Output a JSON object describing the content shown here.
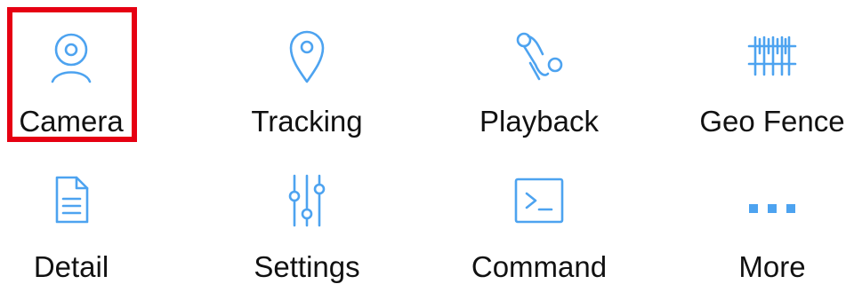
{
  "menu": {
    "items": [
      {
        "label": "Camera",
        "icon": "camera-icon"
      },
      {
        "label": "Tracking",
        "icon": "location-pin-icon"
      },
      {
        "label": "Playback",
        "icon": "route-icon"
      },
      {
        "label": "Geo Fence",
        "icon": "fence-icon"
      },
      {
        "label": "Detail",
        "icon": "document-icon"
      },
      {
        "label": "Settings",
        "icon": "sliders-icon"
      },
      {
        "label": "Command",
        "icon": "terminal-icon"
      },
      {
        "label": "More",
        "icon": "more-dots-icon"
      }
    ]
  },
  "colors": {
    "icon_accent": "#4da3f0",
    "highlight_border": "#e60012",
    "label_text": "#111111"
  }
}
